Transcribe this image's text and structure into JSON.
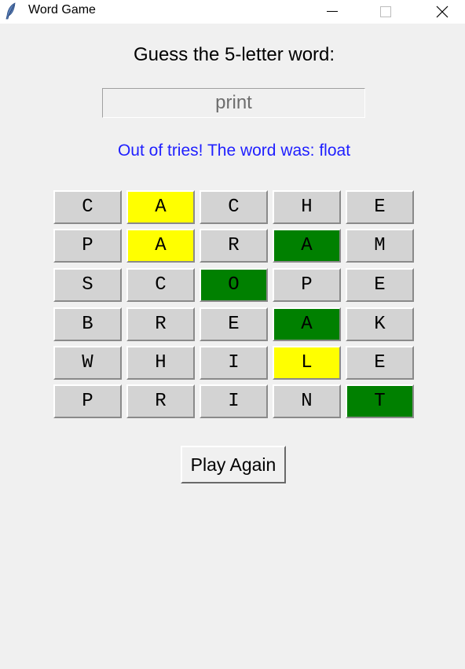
{
  "window": {
    "title": "Word Game",
    "app_icon": "feather-icon"
  },
  "heading": "Guess the 5-letter word:",
  "guess_input": {
    "value": "print"
  },
  "status_message": "Out of tries! The word was: float",
  "colors": {
    "correct": "#008000",
    "present": "#ffff00",
    "absent": "#d3d3d3",
    "status_text": "#1f1fff"
  },
  "board": [
    [
      {
        "letter": "C",
        "state": "absent"
      },
      {
        "letter": "A",
        "state": "present"
      },
      {
        "letter": "C",
        "state": "absent"
      },
      {
        "letter": "H",
        "state": "absent"
      },
      {
        "letter": "E",
        "state": "absent"
      }
    ],
    [
      {
        "letter": "P",
        "state": "absent"
      },
      {
        "letter": "A",
        "state": "present"
      },
      {
        "letter": "R",
        "state": "absent"
      },
      {
        "letter": "A",
        "state": "correct"
      },
      {
        "letter": "M",
        "state": "absent"
      }
    ],
    [
      {
        "letter": "S",
        "state": "absent"
      },
      {
        "letter": "C",
        "state": "absent"
      },
      {
        "letter": "O",
        "state": "correct"
      },
      {
        "letter": "P",
        "state": "absent"
      },
      {
        "letter": "E",
        "state": "absent"
      }
    ],
    [
      {
        "letter": "B",
        "state": "absent"
      },
      {
        "letter": "R",
        "state": "absent"
      },
      {
        "letter": "E",
        "state": "absent"
      },
      {
        "letter": "A",
        "state": "correct"
      },
      {
        "letter": "K",
        "state": "absent"
      }
    ],
    [
      {
        "letter": "W",
        "state": "absent"
      },
      {
        "letter": "H",
        "state": "absent"
      },
      {
        "letter": "I",
        "state": "absent"
      },
      {
        "letter": "L",
        "state": "present"
      },
      {
        "letter": "E",
        "state": "absent"
      }
    ],
    [
      {
        "letter": "P",
        "state": "absent"
      },
      {
        "letter": "R",
        "state": "absent"
      },
      {
        "letter": "I",
        "state": "absent"
      },
      {
        "letter": "N",
        "state": "absent"
      },
      {
        "letter": "T",
        "state": "correct"
      }
    ]
  ],
  "play_again_label": "Play Again"
}
